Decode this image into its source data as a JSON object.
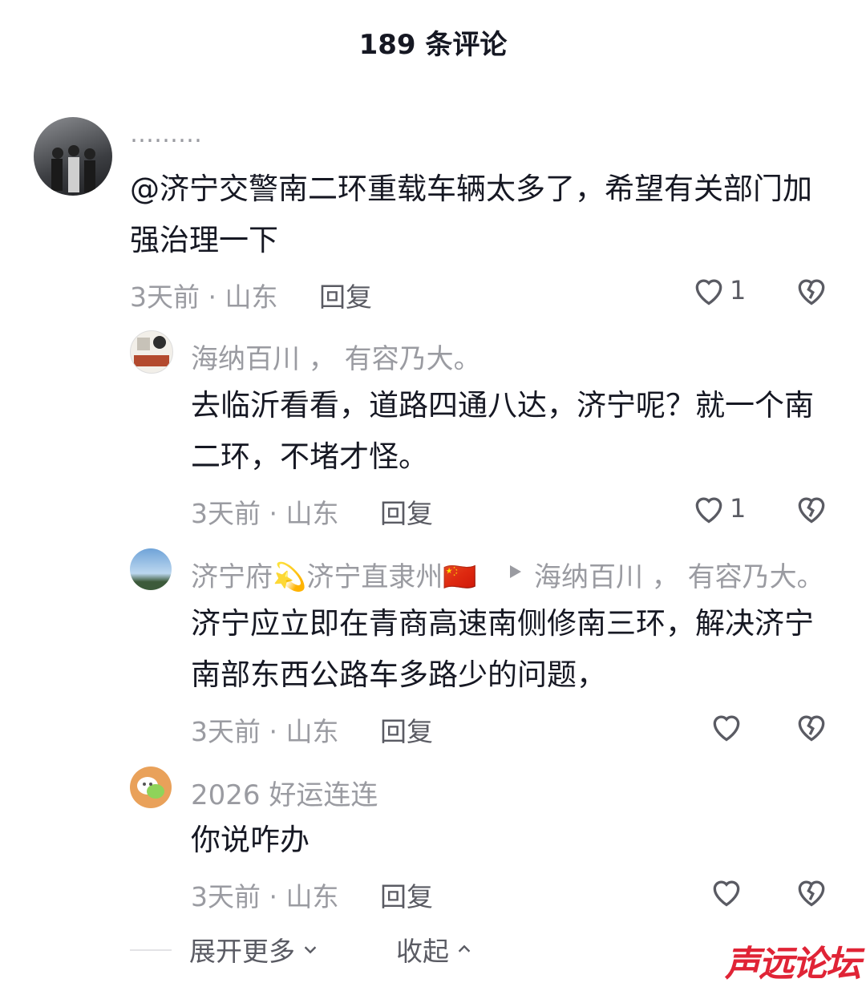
{
  "header": {
    "title": "189 条评论"
  },
  "comments": [
    {
      "username": "………",
      "text": "@济宁交警南二环重载车辆太多了，希望有关部门加强治理一下",
      "meta": "3天前 · 山东",
      "reply_label": "回复",
      "likes": "1"
    },
    {
      "username": "海纳百川 ， 有容乃大。",
      "text": "去临沂看看，道路四通八达，济宁呢？就一个南二环，不堵才怪。",
      "meta": "3天前 · 山东",
      "reply_label": "回复",
      "likes": "1"
    },
    {
      "username": "济宁府💫济宁直隶州🇨🇳",
      "reply_to": "海纳百川 ， 有容乃大。",
      "text": "济宁应立即在青商高速南侧修南三环，解决济宁南部东西公路车多路少的问题，",
      "meta": "3天前 · 山东",
      "reply_label": "回复",
      "likes": ""
    },
    {
      "username": "2026 好运连连",
      "text": "你说咋办",
      "meta": "3天前 · 山东",
      "reply_label": "回复",
      "likes": ""
    }
  ],
  "footer": {
    "expand_label": "展开更多",
    "collapse_label": "收起"
  },
  "watermark": "声远论坛",
  "icons": {
    "like": "heart-outline-icon",
    "dislike": "broken-heart-icon",
    "expand": "chevron-down-icon",
    "collapse": "chevron-up-icon",
    "reply_arrow": "triangle-right-icon"
  }
}
